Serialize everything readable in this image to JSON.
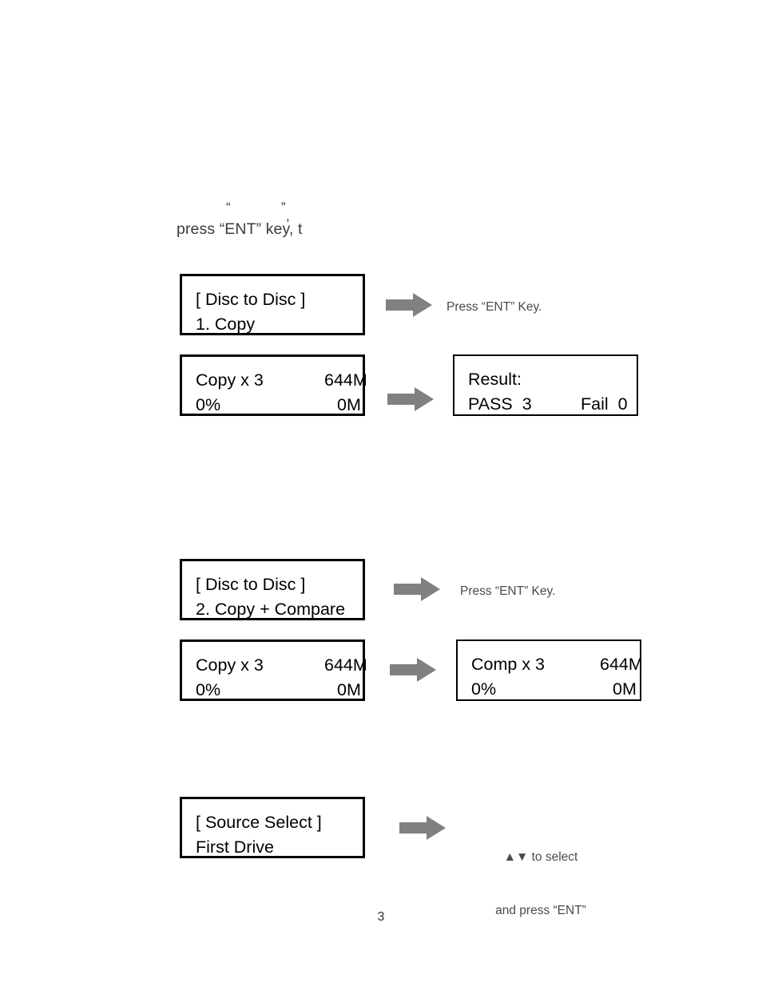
{
  "page": {
    "number": "3",
    "background_color": "#ffffff",
    "text_color": "#231f20",
    "arrow_color": "#808080"
  },
  "intro": {
    "stray_open_quote": "“",
    "stray_close_quote": "”",
    "stray_comma": ",",
    "line": "press “ENT” key, t"
  },
  "sections": [
    {
      "id": "copy",
      "panels": [
        {
          "id": "disc-to-disc-copy",
          "line1_left": "[ Disc to Disc ]",
          "line1_right": "",
          "line2_left": "1. Copy",
          "line2_right": ""
        },
        {
          "id": "copy-progress",
          "line1_left": "Copy x 3",
          "line1_right": "644M",
          "line2_left": "0%",
          "line2_right": "0M"
        },
        {
          "id": "copy-result",
          "line1_left": "Result:",
          "line1_right": "",
          "line2_left": "PASS  3",
          "line2_right": "Fail  0"
        }
      ],
      "notes": [
        {
          "id": "press-ent-copy",
          "text": "Press “ENT” Key."
        }
      ]
    },
    {
      "id": "copy-compare",
      "panels": [
        {
          "id": "disc-to-disc-copy-compare",
          "line1_left": "[ Disc to Disc ]",
          "line1_right": "",
          "line2_left": "2. Copy + Compare",
          "line2_right": ""
        },
        {
          "id": "copy-progress-2",
          "line1_left": "Copy x 3",
          "line1_right": "644M",
          "line2_left": "0%",
          "line2_right": "0M"
        },
        {
          "id": "compare-progress",
          "line1_left": "Comp x 3",
          "line1_right": "644M",
          "line2_left": "0%",
          "line2_right": "0M"
        }
      ],
      "notes": [
        {
          "id": "press-ent-copy-compare",
          "text": "Press “ENT” Key."
        }
      ]
    },
    {
      "id": "source-select",
      "panels": [
        {
          "id": "source-select",
          "line1_left": "[ Source Select ]",
          "line1_right": "",
          "line2_left": "First Drive",
          "line2_right": ""
        }
      ],
      "notes": [
        {
          "id": "select-hint-line1",
          "text": "▲▼ to select"
        },
        {
          "id": "select-hint-line2",
          "text": "and press “ENT”"
        }
      ]
    }
  ],
  "icons": {
    "arrow_right": "arrow-right-icon",
    "triangle_up": "▲",
    "triangle_down": "▼"
  }
}
